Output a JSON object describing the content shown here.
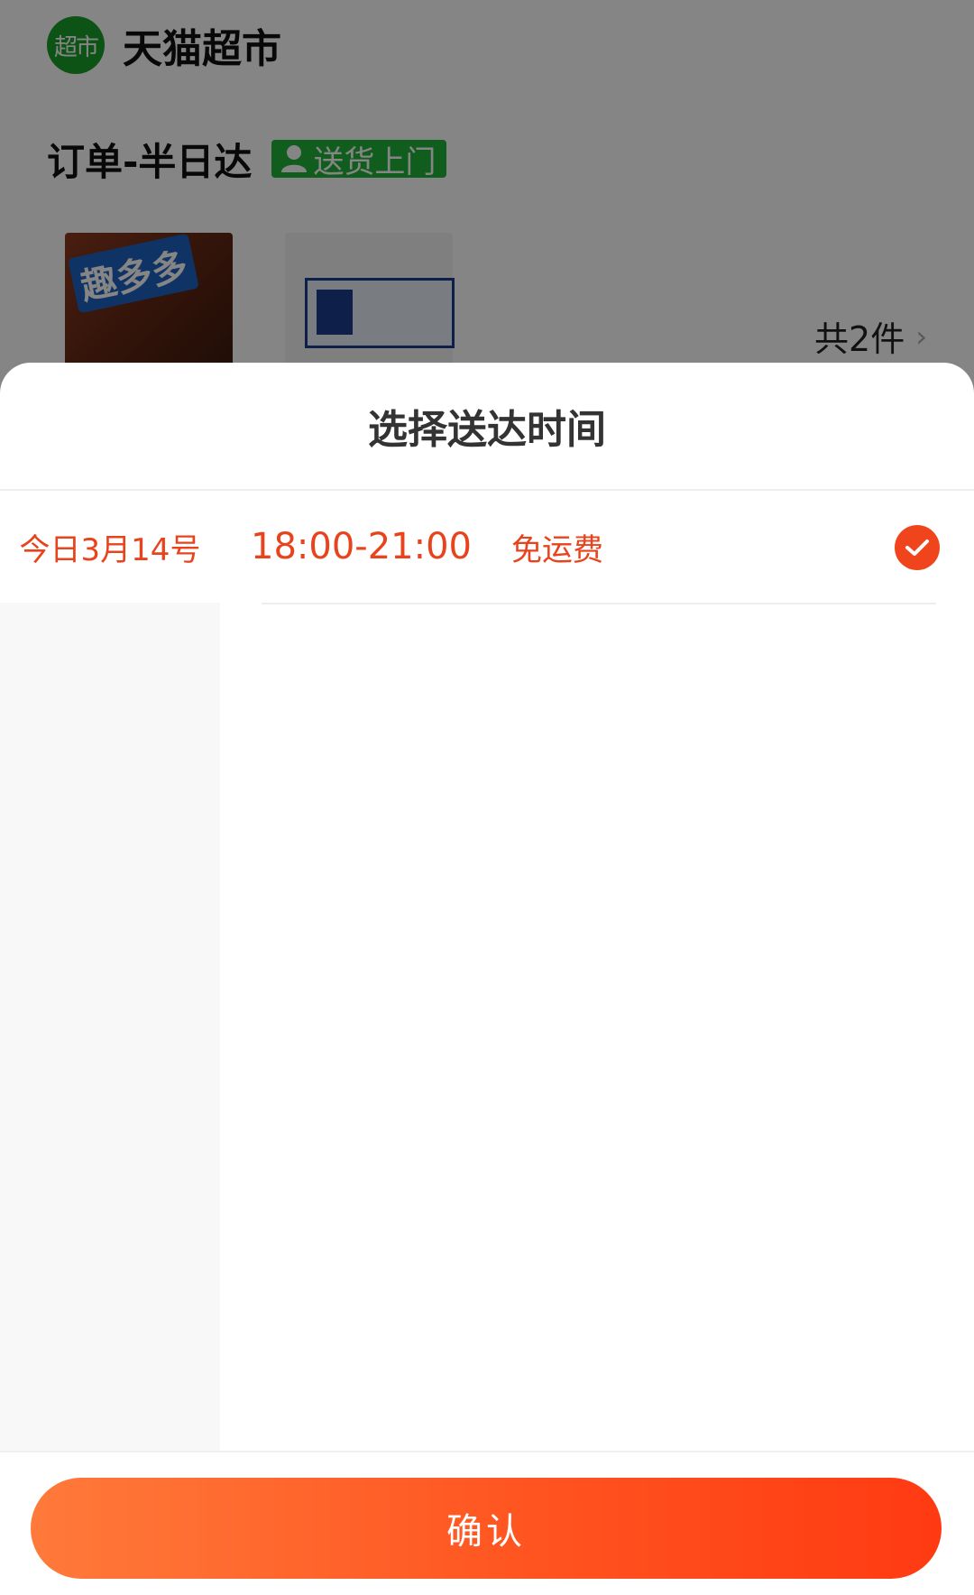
{
  "background": {
    "store_logo_text": "超市",
    "store_name": "天猫超市",
    "order_title": "订单-半日达",
    "delivery_tag": "送货上门",
    "product_1_badge": "趣多多",
    "item_count": "共2件"
  },
  "sheet": {
    "title": "选择送达时间",
    "days": [
      {
        "label": "今日3月14号",
        "selected": true
      }
    ],
    "slots": [
      {
        "time": "18:00-21:00",
        "fee": "免运费",
        "selected": true
      }
    ],
    "confirm_label": "确认"
  },
  "colors": {
    "accent": "#e8431c",
    "check_bg": "#f0451c",
    "button_gradient_start": "#ff7a3a",
    "button_gradient_end": "#ff3a12",
    "store_green": "#1a9f29",
    "tag_green": "#1fb23a"
  },
  "icons": {
    "delivery_tag_icon": "person-icon",
    "item_count_chevron": "chevron-right-icon",
    "slot_check": "check-circle-icon"
  }
}
